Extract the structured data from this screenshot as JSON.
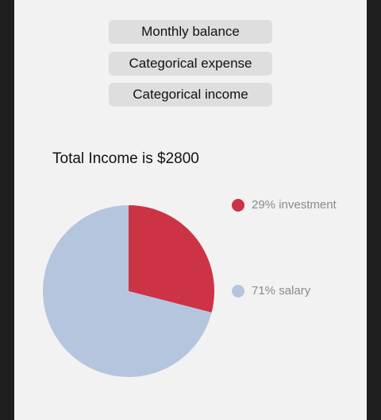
{
  "nav": {
    "buttons": [
      {
        "label": "Monthly balance"
      },
      {
        "label": "Categorical expense"
      },
      {
        "label": "Categorical income"
      }
    ]
  },
  "summary": {
    "title": "Total Income is $2800"
  },
  "colors": {
    "investment": "#cc3344",
    "salary": "#b6c5de",
    "panel_background": "#f2f2f2",
    "frame": "#1e1e1e"
  },
  "legend": [
    {
      "text": "29% investment",
      "color": "#cc3344"
    },
    {
      "text": "71% salary",
      "color": "#b6c5de"
    }
  ],
  "chart_data": {
    "type": "pie",
    "title": "Total Income is $2800",
    "slices": [
      {
        "label": "investment",
        "percent": 29,
        "color": "#cc3344"
      },
      {
        "label": "salary",
        "percent": 71,
        "color": "#b6c5de"
      }
    ],
    "legend_position": "right"
  }
}
